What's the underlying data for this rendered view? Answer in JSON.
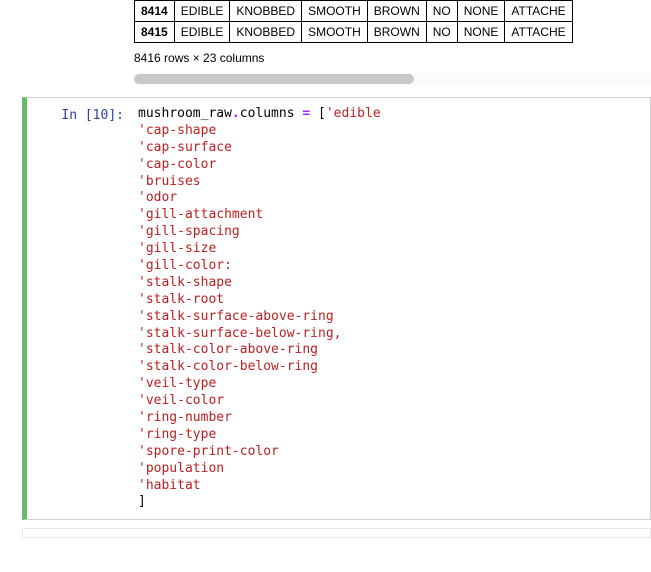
{
  "table": {
    "rows": [
      {
        "idx": "8414",
        "cells": [
          "EDIBLE",
          "KNOBBED",
          "SMOOTH",
          "BROWN",
          "NO",
          "NONE",
          "ATTACHE"
        ]
      },
      {
        "idx": "8415",
        "cells": [
          "EDIBLE",
          "KNOBBED",
          "SMOOTH",
          "BROWN",
          "NO",
          "NONE",
          "ATTACHE"
        ]
      }
    ],
    "shape": "8416 rows × 23 columns"
  },
  "cell": {
    "prompt": "In [10]:",
    "code": {
      "var": "mushroom_raw",
      "attr": "columns",
      "eq": "=",
      "open": "[",
      "first": "'edible",
      "items": [
        "'cap-shape",
        "'cap-surface",
        "'cap-color",
        "'bruises",
        "'odor",
        "'gill-attachment",
        "'gill-spacing",
        "'gill-size",
        "'gill-color:",
        "'stalk-shape",
        "'stalk-root",
        "'stalk-surface-above-ring",
        "'stalk-surface-below-ring,",
        "'stalk-color-above-ring",
        "'stalk-color-below-ring",
        "'veil-type",
        "'veil-color",
        "'ring-number",
        "'ring-type",
        "'spore-print-color",
        "'population",
        "'habitat"
      ],
      "close": "]"
    }
  }
}
